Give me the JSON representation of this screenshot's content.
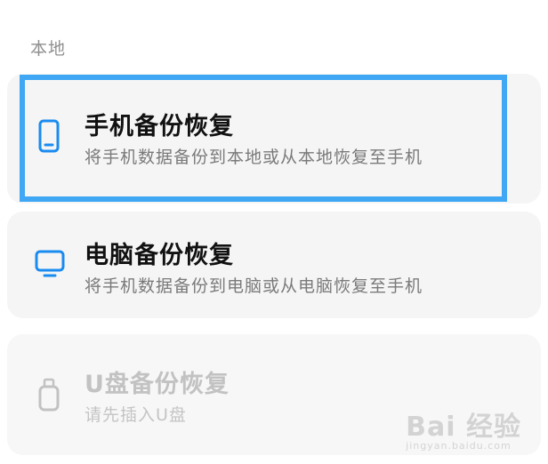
{
  "section": {
    "label": "本地"
  },
  "items": [
    {
      "title": "手机备份恢复",
      "subtitle": "将手机数据备份到本地或从本地恢复至手机",
      "icon": "phone-icon",
      "enabled": true,
      "selected": true
    },
    {
      "title": "电脑备份恢复",
      "subtitle": "将手机数据备份到电脑或从电脑恢复至手机",
      "icon": "monitor-icon",
      "enabled": true,
      "selected": false
    },
    {
      "title": "U盘备份恢复",
      "subtitle": "请先插入U盘",
      "icon": "usb-drive-icon",
      "enabled": false,
      "selected": false
    }
  ],
  "watermark": {
    "main": "Bai 经验",
    "sub": "jingyan.baidu.com"
  },
  "colors": {
    "accent": "#1a8cf0",
    "highlight": "#3fa7f3",
    "card_bg": "#f5f5f5",
    "disabled": "#c2c2c2"
  }
}
